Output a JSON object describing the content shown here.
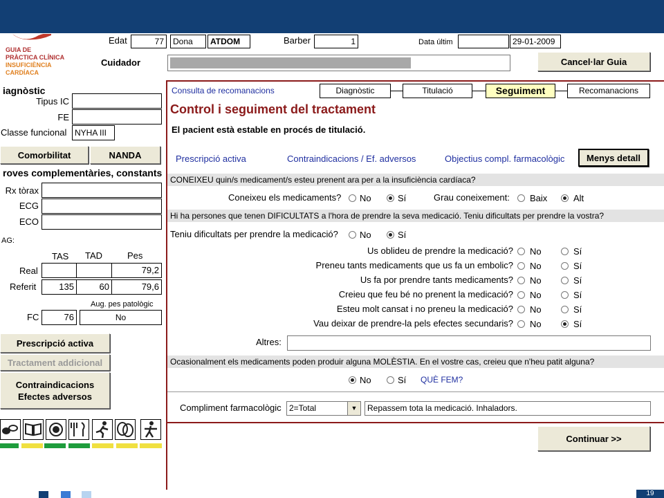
{
  "header": {
    "logo_lines": [
      "Guia de",
      "Pràctica Clínica",
      "Insuficiència",
      "Cardíaca"
    ],
    "edat_label": "Edat",
    "edat_value": "77",
    "sexe_value": "Dona",
    "tipus_value": "ATDOM",
    "barber_label": "Barber",
    "barber_value": "1",
    "data_label": "Data últim",
    "data_value": "29-01-2009",
    "cuidador_label": "Cuidador",
    "cancel_label": "Cancel·lar Guia"
  },
  "left": {
    "diagnostic_title": "iagnòstic",
    "tipus_label": "Tipus IC",
    "fe_label": "FE",
    "classe_label": "Classe funcional",
    "classe_value": "NYHA III",
    "comorbilitat_label": "Comorbilitat",
    "nanda_label": "NANDA",
    "proves_title": "roves complementàries, constants",
    "rx_label": "Rx tòrax",
    "ecg_label": "ECG",
    "eco_label": "ECO",
    "ag_label": "AG:",
    "col_tas": "TAS",
    "col_tad": "TAD",
    "col_pes": "Pes",
    "real_label": "Real",
    "real_tas": "",
    "real_tad": "",
    "real_pes": "79,2",
    "referit_label": "Referit",
    "referit_tas": "135",
    "referit_tad": "60",
    "referit_pes": "79,6",
    "aug_label": "Aug. pes patològic",
    "fc_label": "FC",
    "fc_value": "76",
    "aug_value": "No",
    "prescripcio_btn": "Prescripció activa",
    "tractament_btn": "Tractament addicional",
    "contra_btn_line1": "Contraindicacions",
    "contra_btn_line2": "Efectes adversos",
    "status_colors": [
      "#1e9c3c",
      "#f0e040",
      "#1e9c3c",
      "#1e9c3c",
      "#f0e040",
      "#f0e040",
      "#f0e040"
    ]
  },
  "main": {
    "consulta_link": "Consulta de recomanacions",
    "tabs": [
      "Diagnòstic",
      "Titulació",
      "Seguiment",
      "Recomanacions"
    ],
    "title": "Control i seguiment del tractament",
    "subtitle": "El pacient està estable en procés de titulació.",
    "link_prescripcio": "Prescripció activa",
    "link_contra": "Contraindicacions / Ef. adversos",
    "link_objectius": "Objectius compl. farmacològic",
    "menys_btn": "Menys detall",
    "sec1": "CONEIXEU quin/s medicament/s esteu prenent ara per a la insuficiència cardíaca?",
    "q_coneixeu": "Coneixeu els medicaments?",
    "q_grau": "Grau coneixement:",
    "opt_no": "No",
    "opt_si": "Sí",
    "opt_baix": "Baix",
    "opt_alt": "Alt",
    "sec2": "Hi ha persones que tenen DIFICULTATS a l'hora de prendre la seva medicació. Teniu dificultats per prendre la vostra?",
    "q_dificultats": "Teniu dificultats per prendre la medicació?",
    "sub_questions": [
      "Us oblideu de prendre la medicació?",
      "Preneu tants medicaments que us fa un embolic?",
      "Us fa por prendre tants medicaments?",
      "Creieu que feu bé no prenent la medicació?",
      "Esteu molt cansat i no preneu la medicació?",
      "Vau deixar de prendre-la pels efectes secundaris?"
    ],
    "altres_label": "Altres:",
    "sec3": "Ocasionalment els medicaments poden produir alguna MOLÈSTIA. En el vostre cas, creieu que n'heu patit alguna?",
    "que_fem": "QUÈ FEM?",
    "compliment_label": "Compliment farmacològic",
    "compliment_value": "2=Total",
    "compliment_note": "Repassem tota la medicació. Inhaladors.",
    "continuar_btn": "Continuar >>",
    "page_number": "19"
  }
}
